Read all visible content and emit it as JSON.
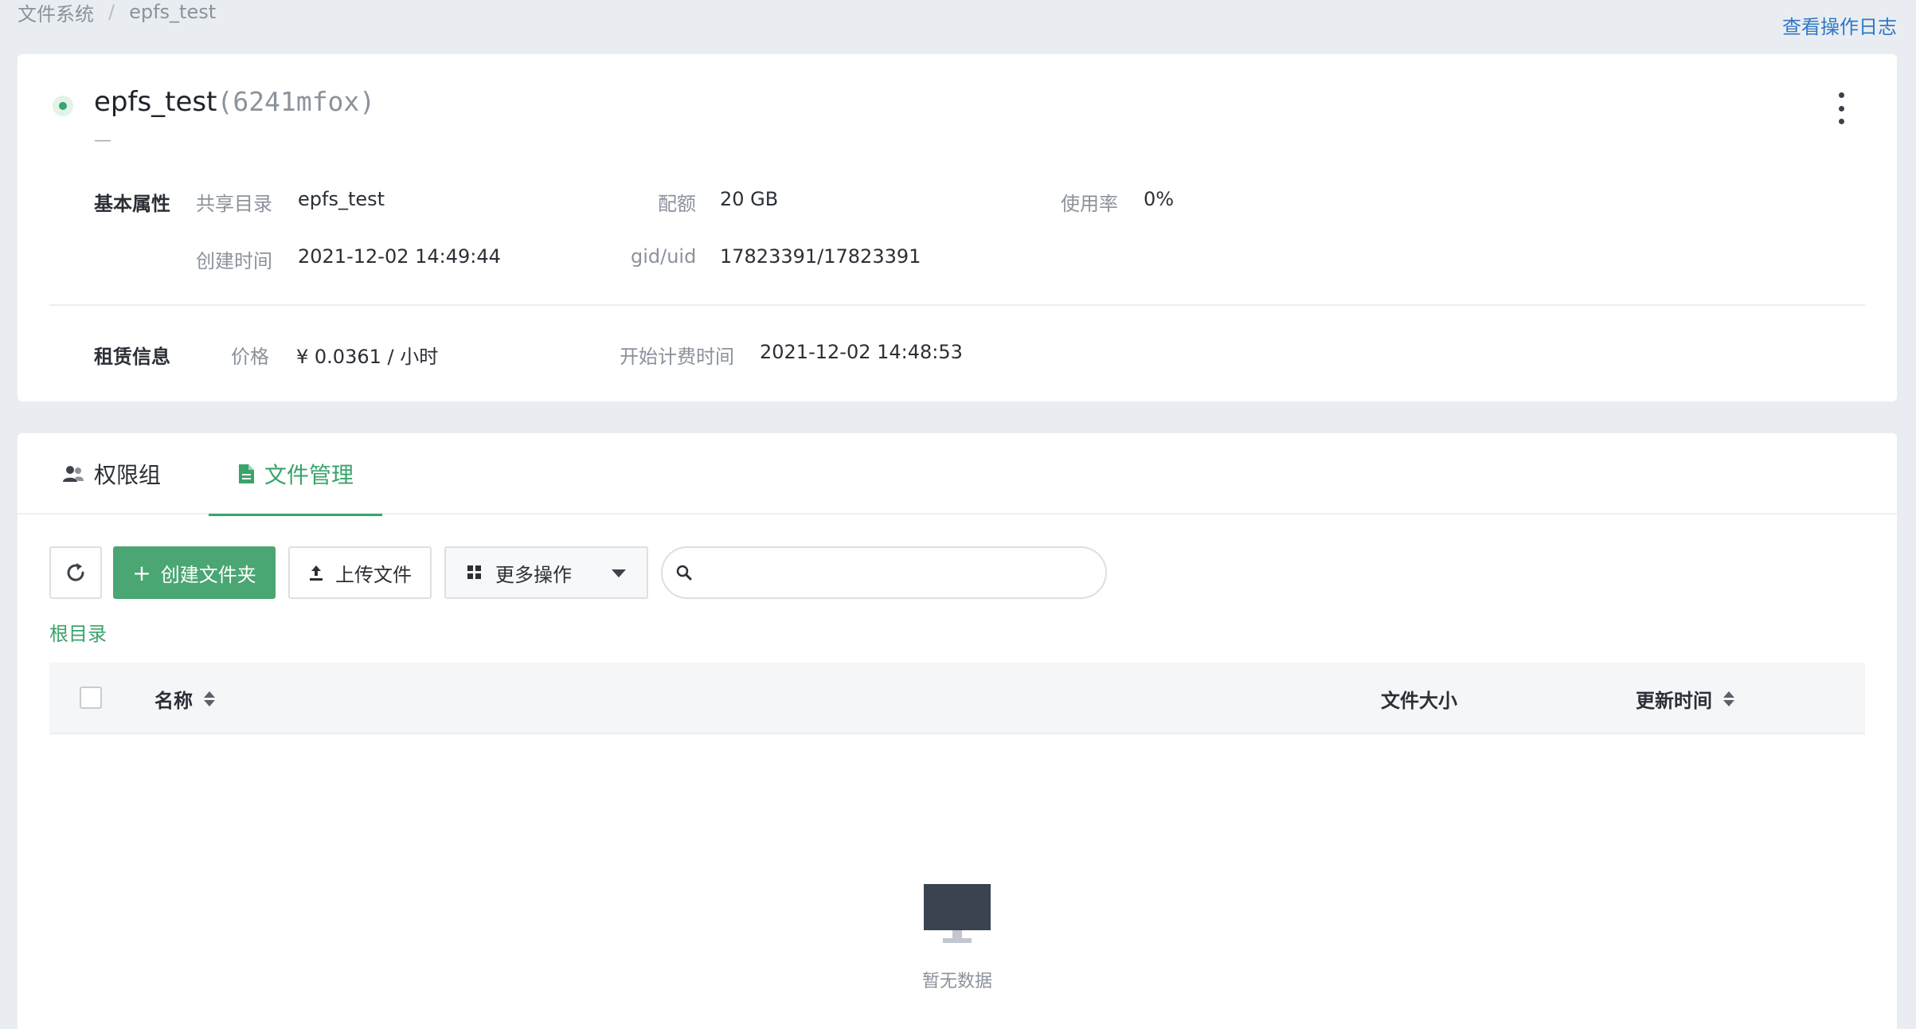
{
  "breadcrumb": {
    "root": "文件系统",
    "separator": "/",
    "current": "epfs_test"
  },
  "header_link": "查看操作日志",
  "filesystem": {
    "name": "epfs_test",
    "id": "(6241mfox)",
    "description": "—",
    "status_color": "#3aa36a"
  },
  "basic": {
    "section": "基本属性",
    "share_dir_label": "共享目录",
    "share_dir_value": "epfs_test",
    "quota_label": "配额",
    "quota_value": "20 GB",
    "usage_label": "使用率",
    "usage_value": "0%",
    "created_label": "创建时间",
    "created_value": "2021-12-02 14:49:44",
    "gid_label": "gid/uid",
    "gid_value": "17823391/17823391"
  },
  "lease": {
    "section": "租赁信息",
    "price_label": "价格",
    "price_value": "¥ 0.0361 / 小时",
    "billing_label": "开始计费时间",
    "billing_value": "2021-12-02 14:48:53"
  },
  "tabs": [
    {
      "label": "权限组",
      "icon": "users-icon",
      "active": false
    },
    {
      "label": "文件管理",
      "icon": "document-icon",
      "active": true
    }
  ],
  "toolbar": {
    "create_folder": "创建文件夹",
    "upload": "上传文件",
    "more_actions": "更多操作",
    "search_placeholder": ""
  },
  "path": {
    "root": "根目录"
  },
  "table": {
    "columns": [
      "名称",
      "文件大小",
      "更新时间"
    ],
    "rows": []
  },
  "empty": {
    "text": "暂无数据"
  },
  "colors": {
    "accent": "#3aa36a",
    "link": "#2f77c8",
    "primary_button": "#4aa672"
  }
}
